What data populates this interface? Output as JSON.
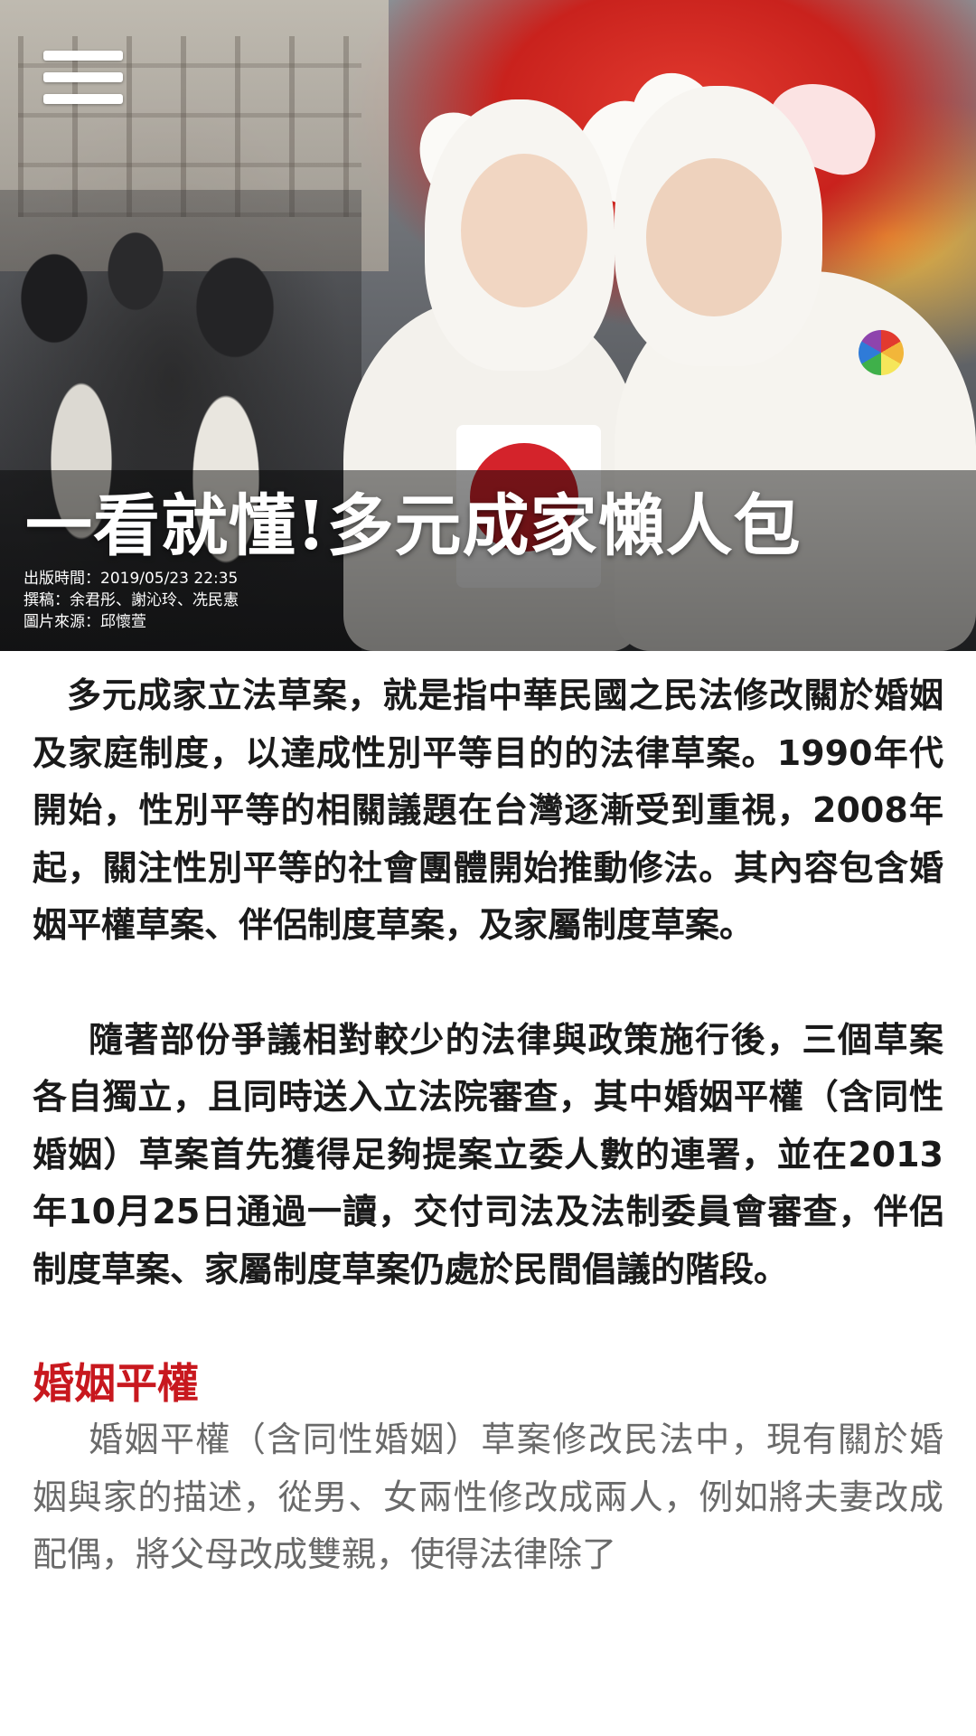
{
  "header": {
    "menu_icon": "hamburger-icon"
  },
  "hero": {
    "title": "一看就懂!多元成家懶人包",
    "publish": "出版時間：2019/05/23 22:35",
    "authors": "撰稿：余君彤、謝沁玲、冼民憲",
    "photo_credit": "圖片來源：邱懷萱"
  },
  "article": {
    "paragraph1": "多元成家立法草案，就是指中華民國之民法修改關於婚姻及家庭制度，以達成性別平等目的的法律草案。1990年代開始，性別平等的相關議題在台灣逐漸受到重視，2008年起，關注性別平等的社會團體開始推動修法。其內容包含婚姻平權草案、伴侶制度草案，及家屬制度草案。",
    "paragraph2": "隨著部份爭議相對較少的法律與政策施行後，三個草案各自獨立，且同時送入立法院審查，其中婚姻平權（含同性婚姻）草案首先獲得足夠提案立委人數的連署，並在2013年10月25日通過一讀，交付司法及法制委員會審查，伴侶制度草案、家屬制度草案仍處於民間倡議的階段。",
    "section_heading": "婚姻平權",
    "paragraph3": "婚姻平權（含同性婚姻）草案修改民法中，現有關於婚姻與家的描述，從男、女兩性修改成兩人，例如將夫妻改成配偶，將父母改成雙親，使得法律除了"
  },
  "colors": {
    "accent_red": "#c8181e",
    "body_text": "#1a1a1a",
    "muted_text": "#6a6a6a"
  }
}
